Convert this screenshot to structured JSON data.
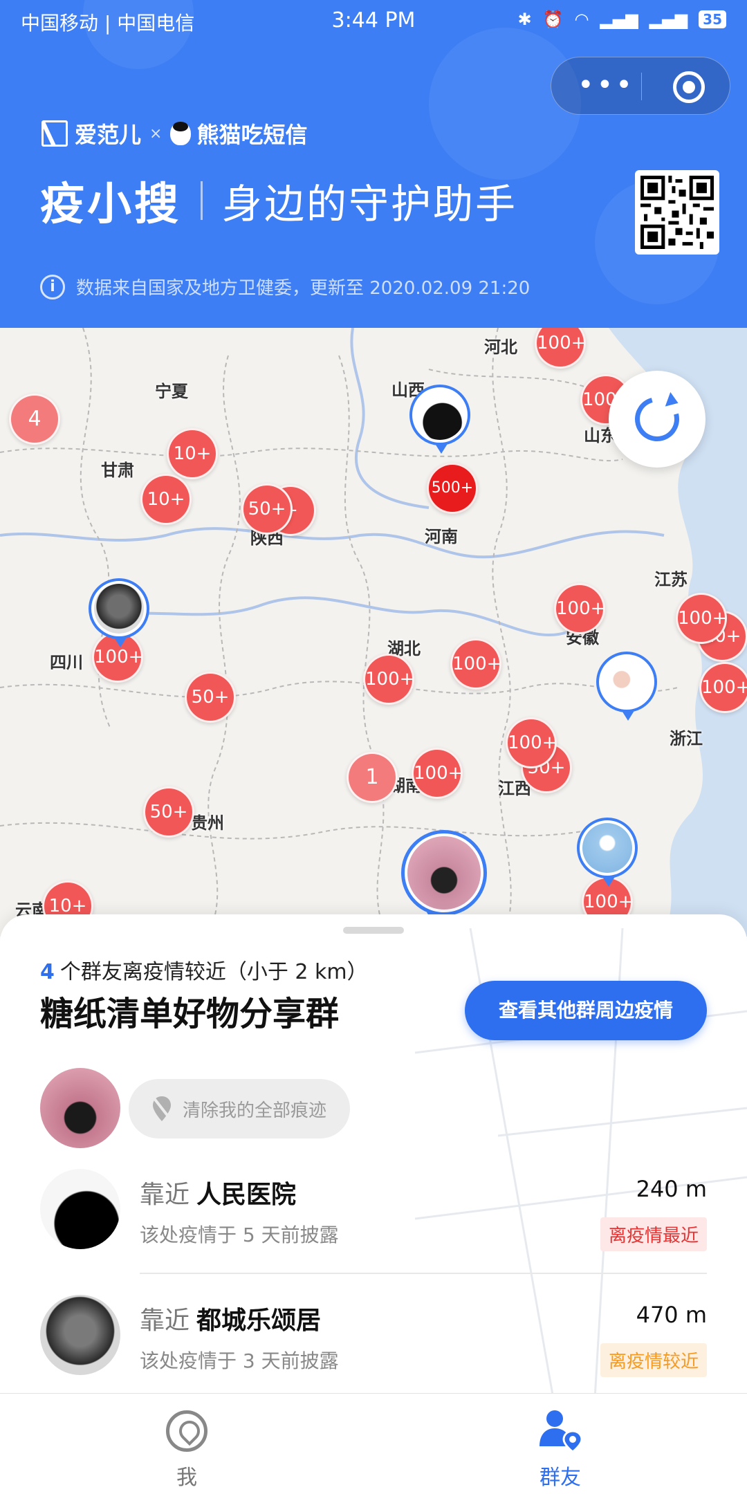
{
  "status_bar": {
    "carrier": "中国移动 | 中国电信",
    "time": "3:44 PM",
    "battery": "35"
  },
  "header": {
    "brand_1": "爱范儿",
    "brand_x": "×",
    "brand_2": "熊猫吃短信",
    "title": "疫小搜",
    "subtitle": "身边的守护助手",
    "data_source": "数据来自国家及地方卫健委，更新至 2020.02.09 21:20",
    "accent": "#3d7ef5"
  },
  "map": {
    "provinces": [
      "河北",
      "宁夏",
      "山西",
      "山东",
      "甘肃",
      "陕西",
      "河南",
      "江苏",
      "四川",
      "湖北",
      "安徽",
      "浙江",
      "江西",
      "湖南",
      "贵州",
      "云南"
    ],
    "clusters": [
      "100+",
      "4",
      "100+",
      "10+",
      "10+",
      "50+",
      "+",
      "500+",
      "100+",
      "100+",
      "10+",
      "100+",
      "100+",
      "100+",
      "100+",
      "50+",
      "100+",
      "50+",
      "1",
      "100+",
      "50+",
      "100+",
      "10+"
    ],
    "cluster_color": "#f25757",
    "hot_cluster_color": "#e81c1c"
  },
  "sheet": {
    "nearby_count": "4",
    "nearby_text": "个群友离疫情较近（小于 2 km）",
    "group_name": "糖纸清单好物分享群",
    "view_other_button": "查看其他群周边疫情",
    "clear_traces_button": "清除我的全部痕迹",
    "items": [
      {
        "near_label": "靠近",
        "place": "人民医院",
        "desc": "该处疫情于 5 天前披露",
        "distance": "240 m",
        "tag": "离疫情最近"
      },
      {
        "near_label": "靠近",
        "place": "都城乐颂居",
        "desc": "该处疫情于 3 天前披露",
        "distance": "470 m",
        "tag": "离疫情较近"
      }
    ]
  },
  "tabbar": {
    "tabs": [
      {
        "label": "我",
        "icon": "location-pin-icon"
      },
      {
        "label": "群友",
        "icon": "friends-location-icon"
      }
    ],
    "active_color": "#2e6ff0"
  }
}
